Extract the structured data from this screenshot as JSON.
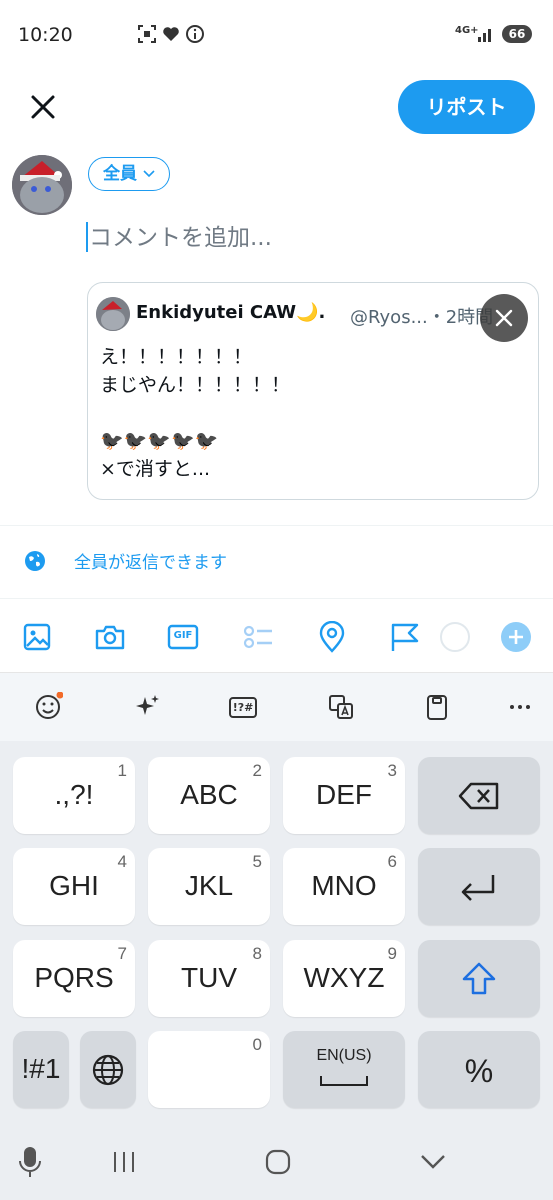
{
  "status_bar": {
    "time": "10:20",
    "network": "4G+",
    "battery": "66"
  },
  "header": {
    "repost_label": "リポスト"
  },
  "composer": {
    "audience_label": "全員",
    "comment_placeholder": "コメントを追加..."
  },
  "quote": {
    "author_name": "Enkidyutei CAW🌙.",
    "handle_time": "@Ryos...・2時間",
    "text": "え！！！！！！！\nまじやん！！！！！！\n\n🐦‍⬛🐦‍⬛🐦‍⬛🐦‍⬛🐦‍⬛\n×で消すと..."
  },
  "reply_setting": {
    "label": "全員が返信できます"
  },
  "toolbar": {
    "gif_label": "GIF"
  },
  "keyboard": {
    "tools": {
      "symbols_label": "!?#"
    },
    "keys": [
      {
        "main": ".,?!",
        "num": "1"
      },
      {
        "main": "ABC",
        "num": "2"
      },
      {
        "main": "DEF",
        "num": "3"
      },
      {
        "main": "GHI",
        "num": "4"
      },
      {
        "main": "JKL",
        "num": "5"
      },
      {
        "main": "MNO",
        "num": "6"
      },
      {
        "main": "PQRS",
        "num": "7"
      },
      {
        "main": "TUV",
        "num": "8"
      },
      {
        "main": "WXYZ",
        "num": "9"
      },
      {
        "main": "!#1"
      },
      {
        "main": "",
        "num": "0"
      },
      {
        "main": "EN(US)"
      },
      {
        "main": "%"
      }
    ]
  },
  "colors": {
    "accent": "#1d9bf0",
    "keyboard_bg": "#ebeef2",
    "key_gray": "#d5d9de"
  }
}
